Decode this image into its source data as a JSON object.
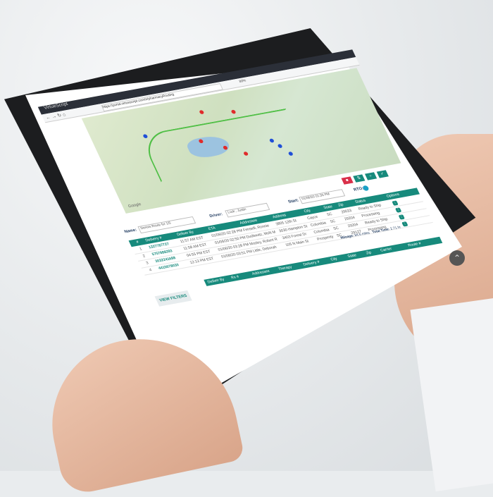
{
  "browser": {
    "tab_title": "VirtueScript",
    "url": "https://portal.virtuescript.com/#/pharmacyRouting",
    "zoom": "80%"
  },
  "map": {
    "attribution": "Google"
  },
  "actions": {
    "delete_icon": "trash-icon",
    "swap_icon": "swap-icon",
    "split_icon": "split-icon",
    "confirm_icon": "check-icon"
  },
  "form": {
    "name_label": "Name:",
    "name_value": "Dennis Route for 1/5",
    "driver_label": "Driver:",
    "driver_value": "Luck , Justin",
    "start_label": "Start:",
    "start_value": "01/06/20 01:35 PM",
    "rto_label": "RTO:"
  },
  "table": {
    "headers": [
      "#",
      "Delivery #",
      "Deliver By",
      "ETA",
      "Addressee",
      "Address",
      "City",
      "State",
      "Zip",
      "Status",
      "Options"
    ],
    "rows": [
      {
        "num": "1",
        "delivery": "1327787727",
        "deliver_by": "11:57 AM EST",
        "eta": "01/06/20 02:28 PM",
        "addressee": "Fenselli, Ronnie",
        "address": "3805 12th St",
        "city": "Cayce",
        "state": "SC",
        "zip": "29033",
        "status": "Ready to Ship"
      },
      {
        "num": "2",
        "delivery": "5757888283",
        "deliver_by": "11:58 AM EST",
        "eta": "01/06/20 02:50 PM",
        "addressee": "Dudlewitz, Molli M",
        "address": "3030 Hampton St",
        "city": "Columbia",
        "state": "SC",
        "zip": "29204",
        "status": "Processing"
      },
      {
        "num": "3",
        "delivery": "3032241688",
        "deliver_by": "04:55 PM EST",
        "eta": "01/06/20 03:28 PM",
        "addressee": "Mosley, Robert R",
        "address": "3403 Forest Dr",
        "city": "Columbia",
        "state": "SC",
        "zip": "29204",
        "status": "Ready to Ship"
      },
      {
        "num": "4",
        "delivery": "4415678030",
        "deliver_by": "12:13 PM EST",
        "eta": "01/06/20 03:51 PM",
        "addressee": "Little, Deborah",
        "address": "105 N Main St",
        "city": "Prosperity",
        "state": "SC",
        "zip": "29127",
        "status": "Processing"
      }
    ]
  },
  "stats": {
    "mileage_label": "Mileage:",
    "mileage_value": "84.6 miles",
    "time_label": "Total Time:",
    "time_value": "2.71 hr"
  },
  "filter_bar": {
    "headers": [
      "Deliver By",
      "Rx #",
      "Addressee",
      "Therapy",
      "Delivery #",
      "City",
      "State",
      "Zip",
      "Carrier",
      "Route #"
    ],
    "view_filters_label": "VIEW FILTERS"
  }
}
